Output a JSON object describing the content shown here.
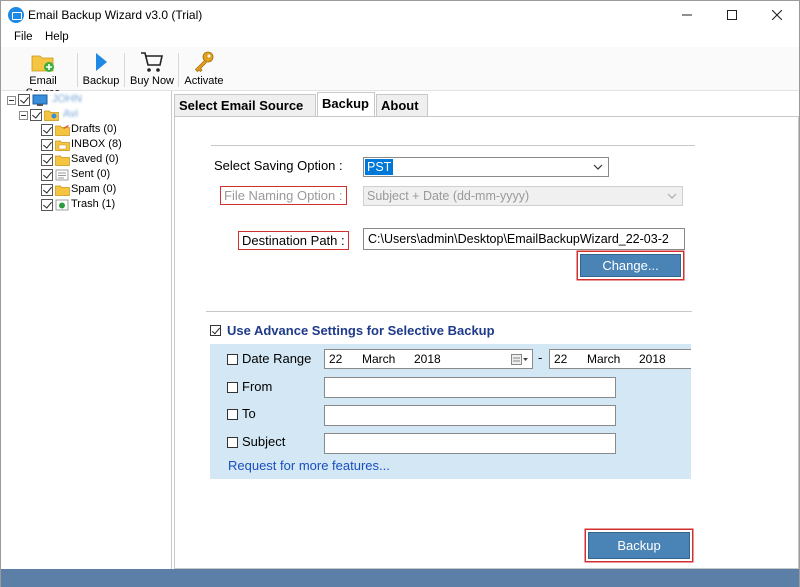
{
  "window": {
    "title": "Email Backup Wizard v3.0 (Trial)",
    "controls": {
      "minimize": "—",
      "maximize": "☐",
      "close": "✕"
    }
  },
  "menu": {
    "file": "File",
    "help": "Help"
  },
  "toolbar": {
    "email_source": "Email Source",
    "backup": "Backup",
    "buy_now": "Buy Now",
    "activate": "Activate"
  },
  "tree": {
    "root_label": "JOHN",
    "account_label": "Avi",
    "folders": [
      {
        "label": "Drafts (0)",
        "icon": "drafts-folder-icon"
      },
      {
        "label": "INBOX (8)",
        "icon": "inbox-folder-icon"
      },
      {
        "label": "Saved (0)",
        "icon": "folder-icon"
      },
      {
        "label": "Sent (0)",
        "icon": "sent-folder-icon"
      },
      {
        "label": "Spam (0)",
        "icon": "folder-icon"
      },
      {
        "label": "Trash (1)",
        "icon": "trash-folder-icon"
      }
    ]
  },
  "tabs": {
    "select_source": "Select Email Source",
    "backup": "Backup",
    "about": "About"
  },
  "backup": {
    "saving_option_label": "Select Saving Option :",
    "saving_option_value": "PST",
    "naming_option_label": "File Naming Option :",
    "naming_option_value": "Subject + Date (dd-mm-yyyy)",
    "destination_label": "Destination Path :",
    "destination_value": "C:\\Users\\admin\\Desktop\\EmailBackupWizard_22-03-2",
    "change_button": "Change...",
    "advance_label": "Use Advance Settings for Selective Backup",
    "date_range_label": "Date Range",
    "date_from": {
      "day": "22",
      "month": "March",
      "year": "2018"
    },
    "date_separator": "-",
    "date_to": {
      "day": "22",
      "month": "March",
      "year": "2018"
    },
    "from_label": "From",
    "to_label": "To",
    "subject_label": "Subject",
    "from_value": "",
    "to_value": "",
    "subject_value": "",
    "more_features_link": "Request for more features...",
    "backup_button": "Backup"
  },
  "colors": {
    "accent_blue": "#4a84b6",
    "highlight_red": "#d32f2f",
    "advanced_panel": "#d3e8f4",
    "link": "#1a4ec0",
    "status_bar": "#5b7fa6"
  }
}
